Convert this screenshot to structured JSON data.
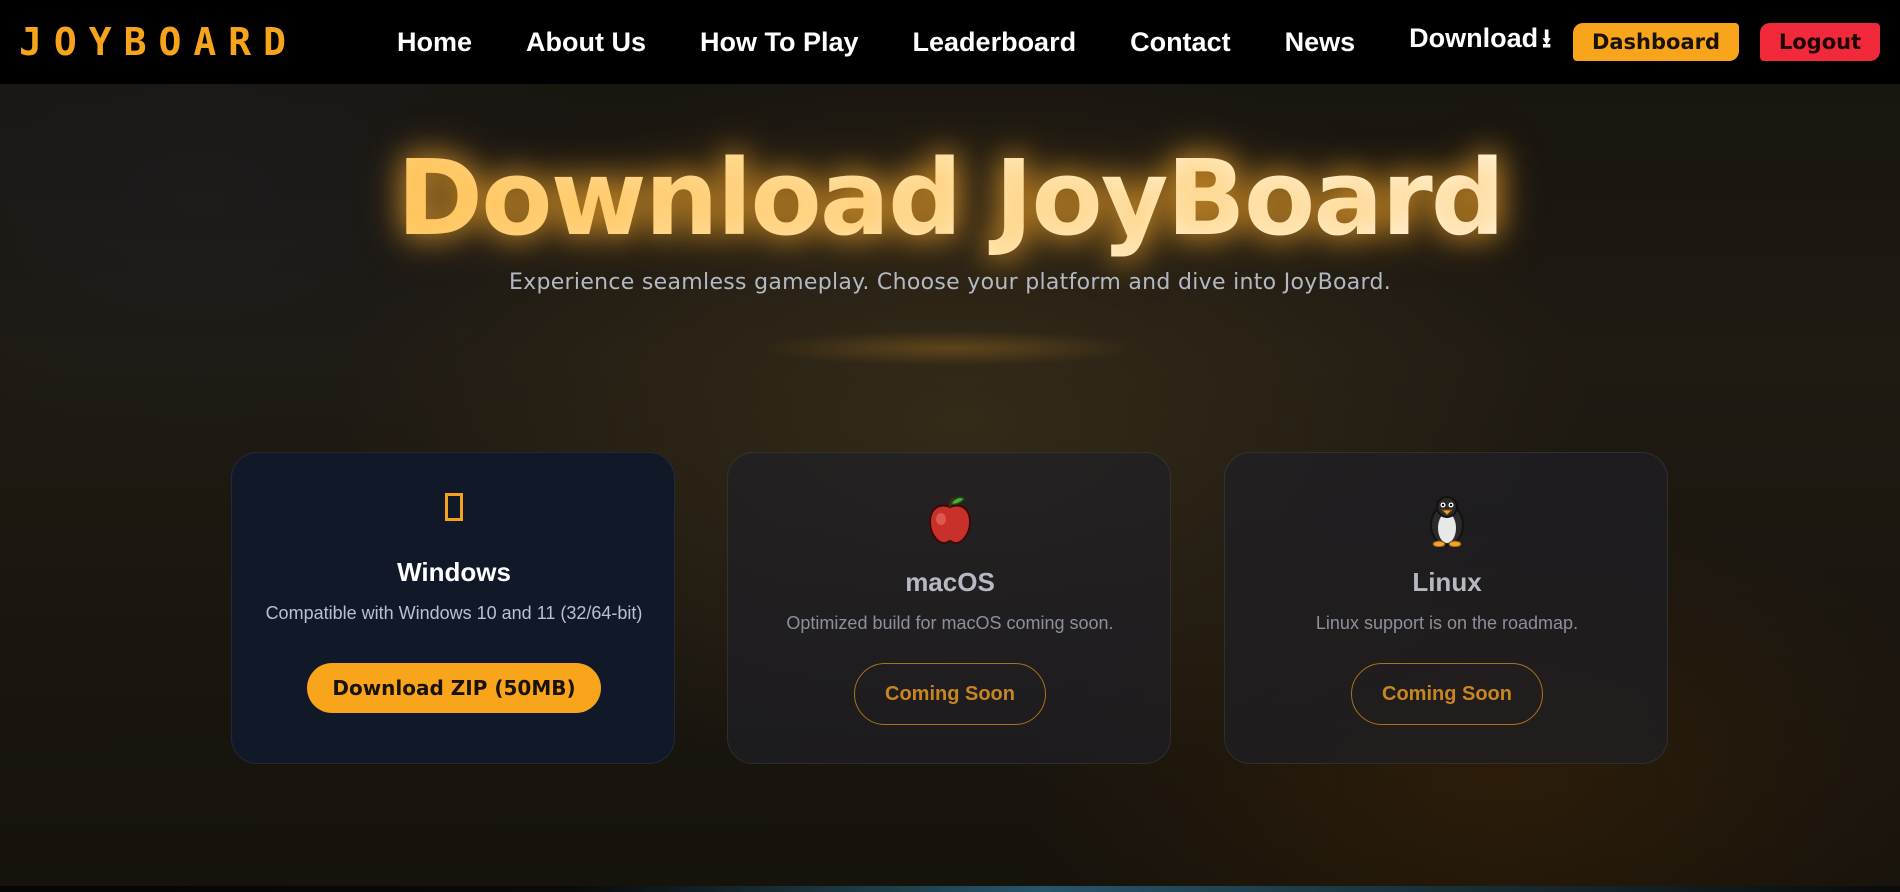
{
  "brand": "JOYBOARD",
  "nav": {
    "links": [
      {
        "label": "Home"
      },
      {
        "label": "About Us"
      },
      {
        "label": "How To Play"
      },
      {
        "label": "Leaderboard"
      },
      {
        "label": "Contact"
      },
      {
        "label": "News"
      },
      {
        "label": "Download",
        "icon": "⭳"
      }
    ],
    "dashboard_label": "Dashboard",
    "logout_label": "Logout"
  },
  "hero": {
    "title": "Download JoyBoard",
    "subtitle": "Experience seamless gameplay. Choose your platform and dive into JoyBoard."
  },
  "cards": {
    "windows": {
      "icon": "windows-icon",
      "title": "Windows",
      "desc": "Compatible with Windows 10 and 11 (32/64-bit)",
      "button": "Download ZIP (50MB)"
    },
    "mac": {
      "icon": "🍎",
      "title": "macOS",
      "desc": "Optimized build for macOS coming soon.",
      "button": "Coming Soon"
    },
    "linux": {
      "icon": "🐧",
      "title": "Linux",
      "desc": "Linux support is on the roadmap.",
      "button": "Coming Soon"
    }
  },
  "colors": {
    "accent": "#f8a51c",
    "logout": "#f2293a",
    "navbar": "#000000"
  }
}
